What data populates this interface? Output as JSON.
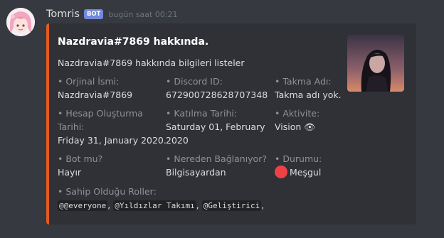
{
  "message": {
    "username": "Tomris",
    "bot_tag": "BOT",
    "timestamp": "bugün saat 00:21"
  },
  "embed": {
    "accent_color": "#e35b20",
    "title": "Nazdravia#7869 hakkında.",
    "description": "Nazdravia#7869 hakkında bilgileri listeler",
    "fields": {
      "original_name": {
        "name": "• Orjinal İsmi:",
        "value": "Nazdravia#7869"
      },
      "discord_id": {
        "name": "• Discord ID:",
        "value": "672900728628707348"
      },
      "nickname": {
        "name": "• Takma Adı:",
        "value": "Takma adı yok."
      },
      "account_created": {
        "name_line1": "• Hesap Oluşturma",
        "name_line2": "Tarihi:",
        "value": "Friday 31, January 2020."
      },
      "joined": {
        "name": "• Katılma Tarihi:",
        "value_line1": "Saturday 01, February",
        "value_line2": "2020"
      },
      "activity": {
        "name": "• Aktivite:",
        "value": "Vision",
        "emoji": "👁"
      },
      "is_bot": {
        "name": "• Bot mu?",
        "value": "Hayır"
      },
      "connected_from": {
        "name": "• Nereden Bağlanıyor?",
        "value": "Bilgisayardan"
      },
      "status": {
        "name": "• Durumu:",
        "value": "Meşgul",
        "dot_color": "#ed4245"
      },
      "roles": {
        "name": "• Sahip Olduğu Roller:",
        "items": [
          "@@everyone",
          "@Yıldızlar Takımı",
          "@Geliştirici"
        ],
        "separator": ","
      }
    }
  }
}
